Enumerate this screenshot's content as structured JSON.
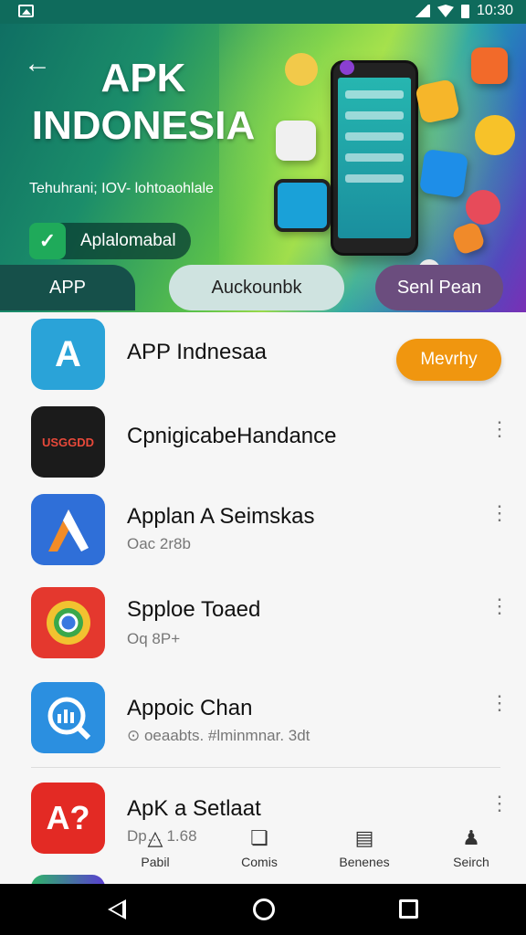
{
  "status_bar": {
    "time": "10:30"
  },
  "hero": {
    "back_icon": "arrow-left-icon",
    "title": "APK INDONESIA",
    "subtitle": "Tehuhrani; IOV- lohtoaohlale",
    "badge_label": "Aplalomabal"
  },
  "tabs": [
    {
      "label": "APP"
    },
    {
      "label": "Auckounbk"
    },
    {
      "label": "Senl Pean"
    }
  ],
  "apps": [
    {
      "title": "APP Indnesaa",
      "subtitle": "",
      "action_label": "Mevrhy",
      "icon_color": "#2aa3d8",
      "icon_text": "A"
    },
    {
      "title": "CpnigicabeHandance",
      "subtitle": "",
      "icon_color": "#1b1b1b",
      "icon_text": "USGGDD"
    },
    {
      "title": "Applan A Seimskas",
      "subtitle": "Oac 2r8b",
      "icon_color": "#2f6fd8",
      "icon_text": ""
    },
    {
      "title": "Spploe Toaed",
      "subtitle": "Oq 8P+",
      "icon_color": "#e4382e",
      "icon_text": ""
    },
    {
      "title": "Appoic Chan",
      "subtitle": "⊙ oeaabts. #lminmnar. 3dt",
      "icon_color": "#2b8fe0",
      "icon_text": ""
    },
    {
      "title": "ApK a Setlaat",
      "subtitle": "Dp… 1.68",
      "icon_color": "#e32a24",
      "icon_text": "A?"
    }
  ],
  "bottom_tabs": [
    {
      "label": "Pabil",
      "icon": "apps-icon"
    },
    {
      "label": "Comis",
      "icon": "game-icon"
    },
    {
      "label": "Benenes",
      "icon": "book-icon"
    },
    {
      "label": "Seirch",
      "icon": "user-icon"
    }
  ],
  "colors": {
    "accent": "#f0960f",
    "hero_dark": "#0f6b5c"
  }
}
